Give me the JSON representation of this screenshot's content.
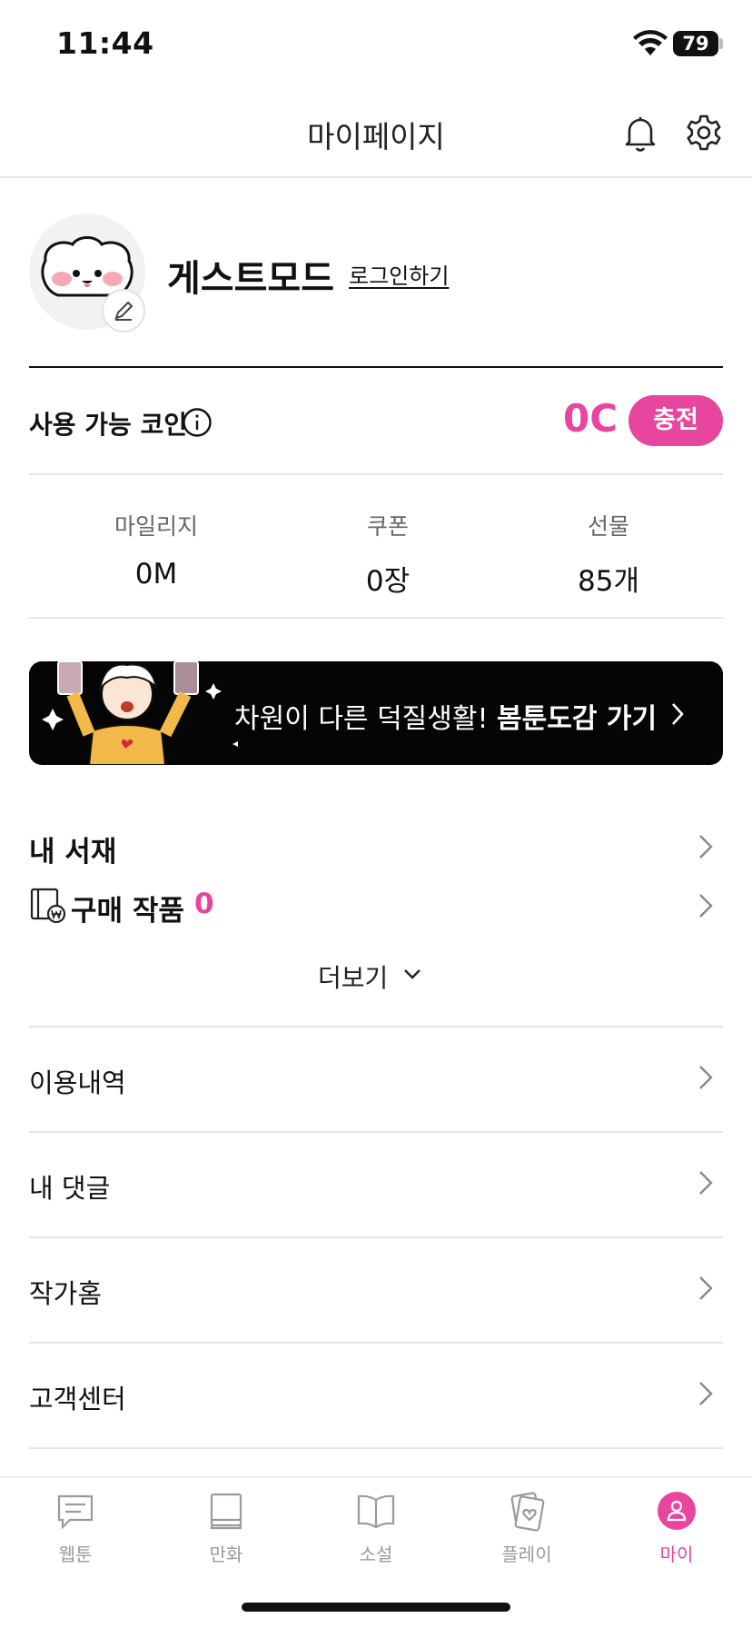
{
  "status_bar": {
    "time": "11:44",
    "battery": "79"
  },
  "header": {
    "title": "마이페이지",
    "icons": [
      "bell-icon",
      "gear-icon"
    ]
  },
  "profile": {
    "name": "게스트모드",
    "login_link": "로그인하기"
  },
  "coins": {
    "label": "사용 가능 코인",
    "amount": "0C",
    "charge_button": "충전"
  },
  "stats": [
    {
      "label": "마일리지",
      "value": "0M"
    },
    {
      "label": "쿠폰",
      "value": "0장"
    },
    {
      "label": "선물",
      "value": "85개"
    }
  ],
  "banner": {
    "text_regular": "차원이 다른 덕질생활! ",
    "text_bold": "봄툰도감 가기"
  },
  "library": {
    "title": "내 서재",
    "purchase_label": "구매 작품",
    "purchase_count": "0",
    "more_label": "더보기"
  },
  "menu": [
    {
      "label": "이용내역"
    },
    {
      "label": "내 댓글"
    },
    {
      "label": "작가홈"
    },
    {
      "label": "고객센터"
    }
  ],
  "tabs": [
    {
      "label": "웹툰",
      "icon": "webtoon-icon"
    },
    {
      "label": "만화",
      "icon": "comic-icon"
    },
    {
      "label": "소설",
      "icon": "novel-icon"
    },
    {
      "label": "플레이",
      "icon": "play-icon"
    },
    {
      "label": "마이",
      "icon": "my-icon",
      "active": true
    }
  ],
  "colors": {
    "accent": "#e8459f",
    "text": "#111111",
    "muted": "#9a9a9a"
  }
}
